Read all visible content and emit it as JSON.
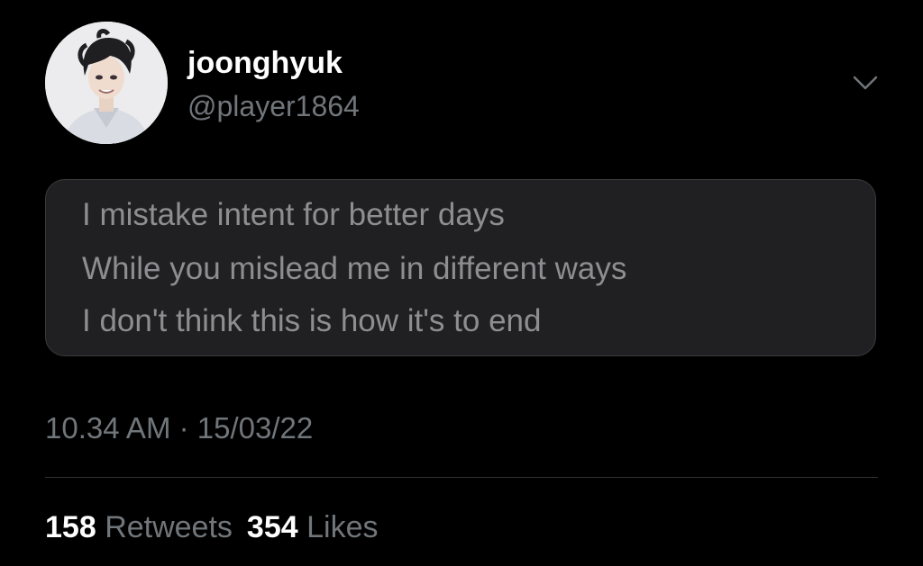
{
  "user": {
    "display_name": "joonghyuk",
    "handle": "@player1864",
    "avatar_icon": "avatar-illustration"
  },
  "menu": {
    "icon": "chevron-down-icon"
  },
  "tweet": {
    "lines": [
      "I mistake intent for better days",
      "While you mislead me in different ways",
      "I don't think this is how it's to end"
    ],
    "timestamp": "10.34 AM · 15/03/22"
  },
  "stats": {
    "retweets": {
      "count": "158",
      "label": "Retweets"
    },
    "likes": {
      "count": "354",
      "label": "Likes"
    }
  },
  "colors": {
    "background": "#000000",
    "primary_text": "#ffffff",
    "secondary_text": "#71767b",
    "quote_text": "#8e8e92",
    "quote_background": "#202023",
    "divider": "#2f3336"
  }
}
